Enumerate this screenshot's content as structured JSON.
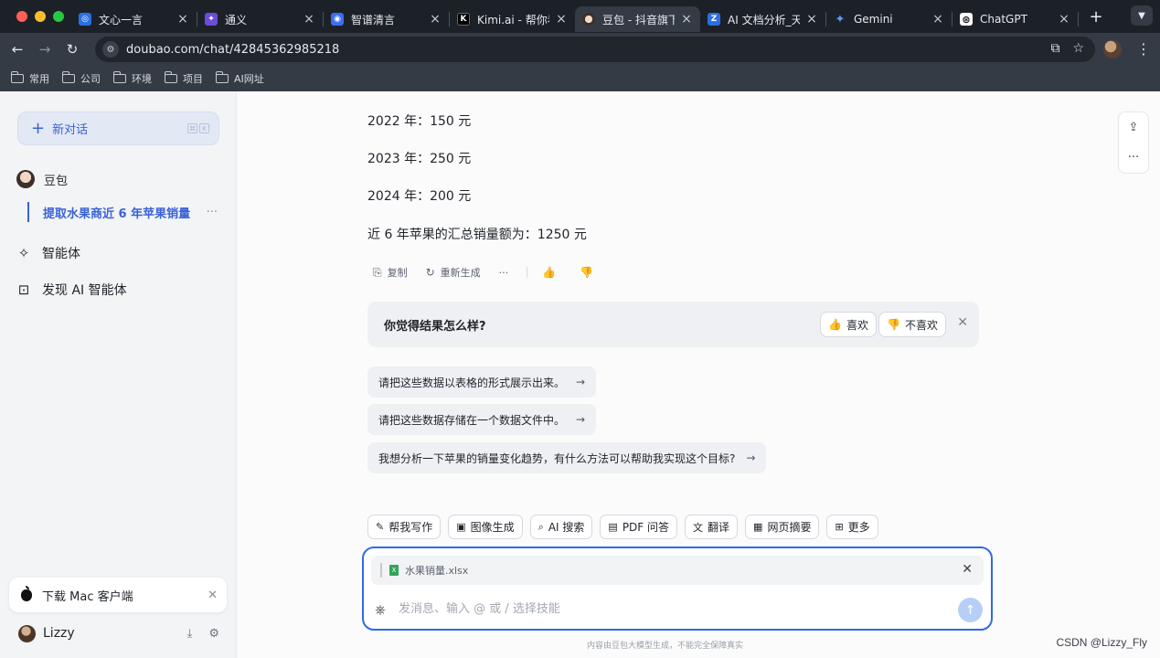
{
  "browser": {
    "tabs": [
      {
        "title": "文心一言",
        "color": "#2b6fe6",
        "glyph": "◎"
      },
      {
        "title": "通义",
        "color": "#6a4cd6",
        "glyph": "✦"
      },
      {
        "title": "智谱清言",
        "color": "#3d6cf0",
        "glyph": "◉"
      },
      {
        "title": "Kimi.ai - 帮你看",
        "color": "#111111",
        "glyph": "K"
      },
      {
        "title": "豆包 - 抖音旗下",
        "color": "#c99a7a",
        "glyph": "●",
        "active": true
      },
      {
        "title": "AI 文档分析_天",
        "color": "#2b6fe6",
        "glyph": "Z"
      },
      {
        "title": "Gemini",
        "color": "#1f2329",
        "glyph": "✦"
      },
      {
        "title": "ChatGPT",
        "color": "#ffffff",
        "glyph": "⊛"
      }
    ],
    "url": "doubao.com/chat/42845362985218",
    "bookmarks": [
      "常用",
      "公司",
      "环境",
      "项目",
      "AI网址"
    ]
  },
  "sidebar": {
    "new_chat_label": "新对话",
    "shortcut_keys": [
      "⌘",
      "K"
    ],
    "bot_name": "豆包",
    "conversation": "提取水果商近 6 年苹果销量",
    "conversation_more": "···",
    "agents_label": "智能体",
    "discover_label": "发现 AI 智能体",
    "download_card": "下载 Mac 客户端",
    "user_name": "Lizzy"
  },
  "main": {
    "message_lines": [
      "2022 年：150 元",
      "2023 年：250 元",
      "2024 年：200 元",
      "近 6 年苹果的汇总销量额为：1250 元"
    ],
    "actions": {
      "copy": "复制",
      "regenerate": "重新生成",
      "more": "···"
    },
    "feedback": {
      "question": "你觉得结果怎么样?",
      "like": "喜欢",
      "dislike": "不喜欢"
    },
    "suggestions": [
      "请把这些数据以表格的形式展示出来。",
      "请把这些数据存储在一个数据文件中。",
      "我想分析一下苹果的销量变化趋势，有什么方法可以帮助我实现这个目标?"
    ],
    "skills": [
      {
        "label": "帮我写作",
        "icon": "✎"
      },
      {
        "label": "图像生成",
        "icon": "▣"
      },
      {
        "label": "AI 搜索",
        "icon": "⌕"
      },
      {
        "label": "PDF 问答",
        "icon": "▤"
      },
      {
        "label": "翻译",
        "icon": "文"
      },
      {
        "label": "网页摘要",
        "icon": "▦"
      },
      {
        "label": "更多",
        "icon": "⊞"
      }
    ],
    "attachment": "水果销量.xlsx",
    "input_placeholder": "发消息、输入 @ 或 / 选择技能",
    "disclaimer": "内容由豆包大模型生成，不能完全保障真实"
  },
  "watermark": "CSDN @Lizzy_Fly",
  "colors": {
    "accent": "#3a62d7",
    "composer_border": "#2f6ae6",
    "tabbar": "#1c2128"
  }
}
